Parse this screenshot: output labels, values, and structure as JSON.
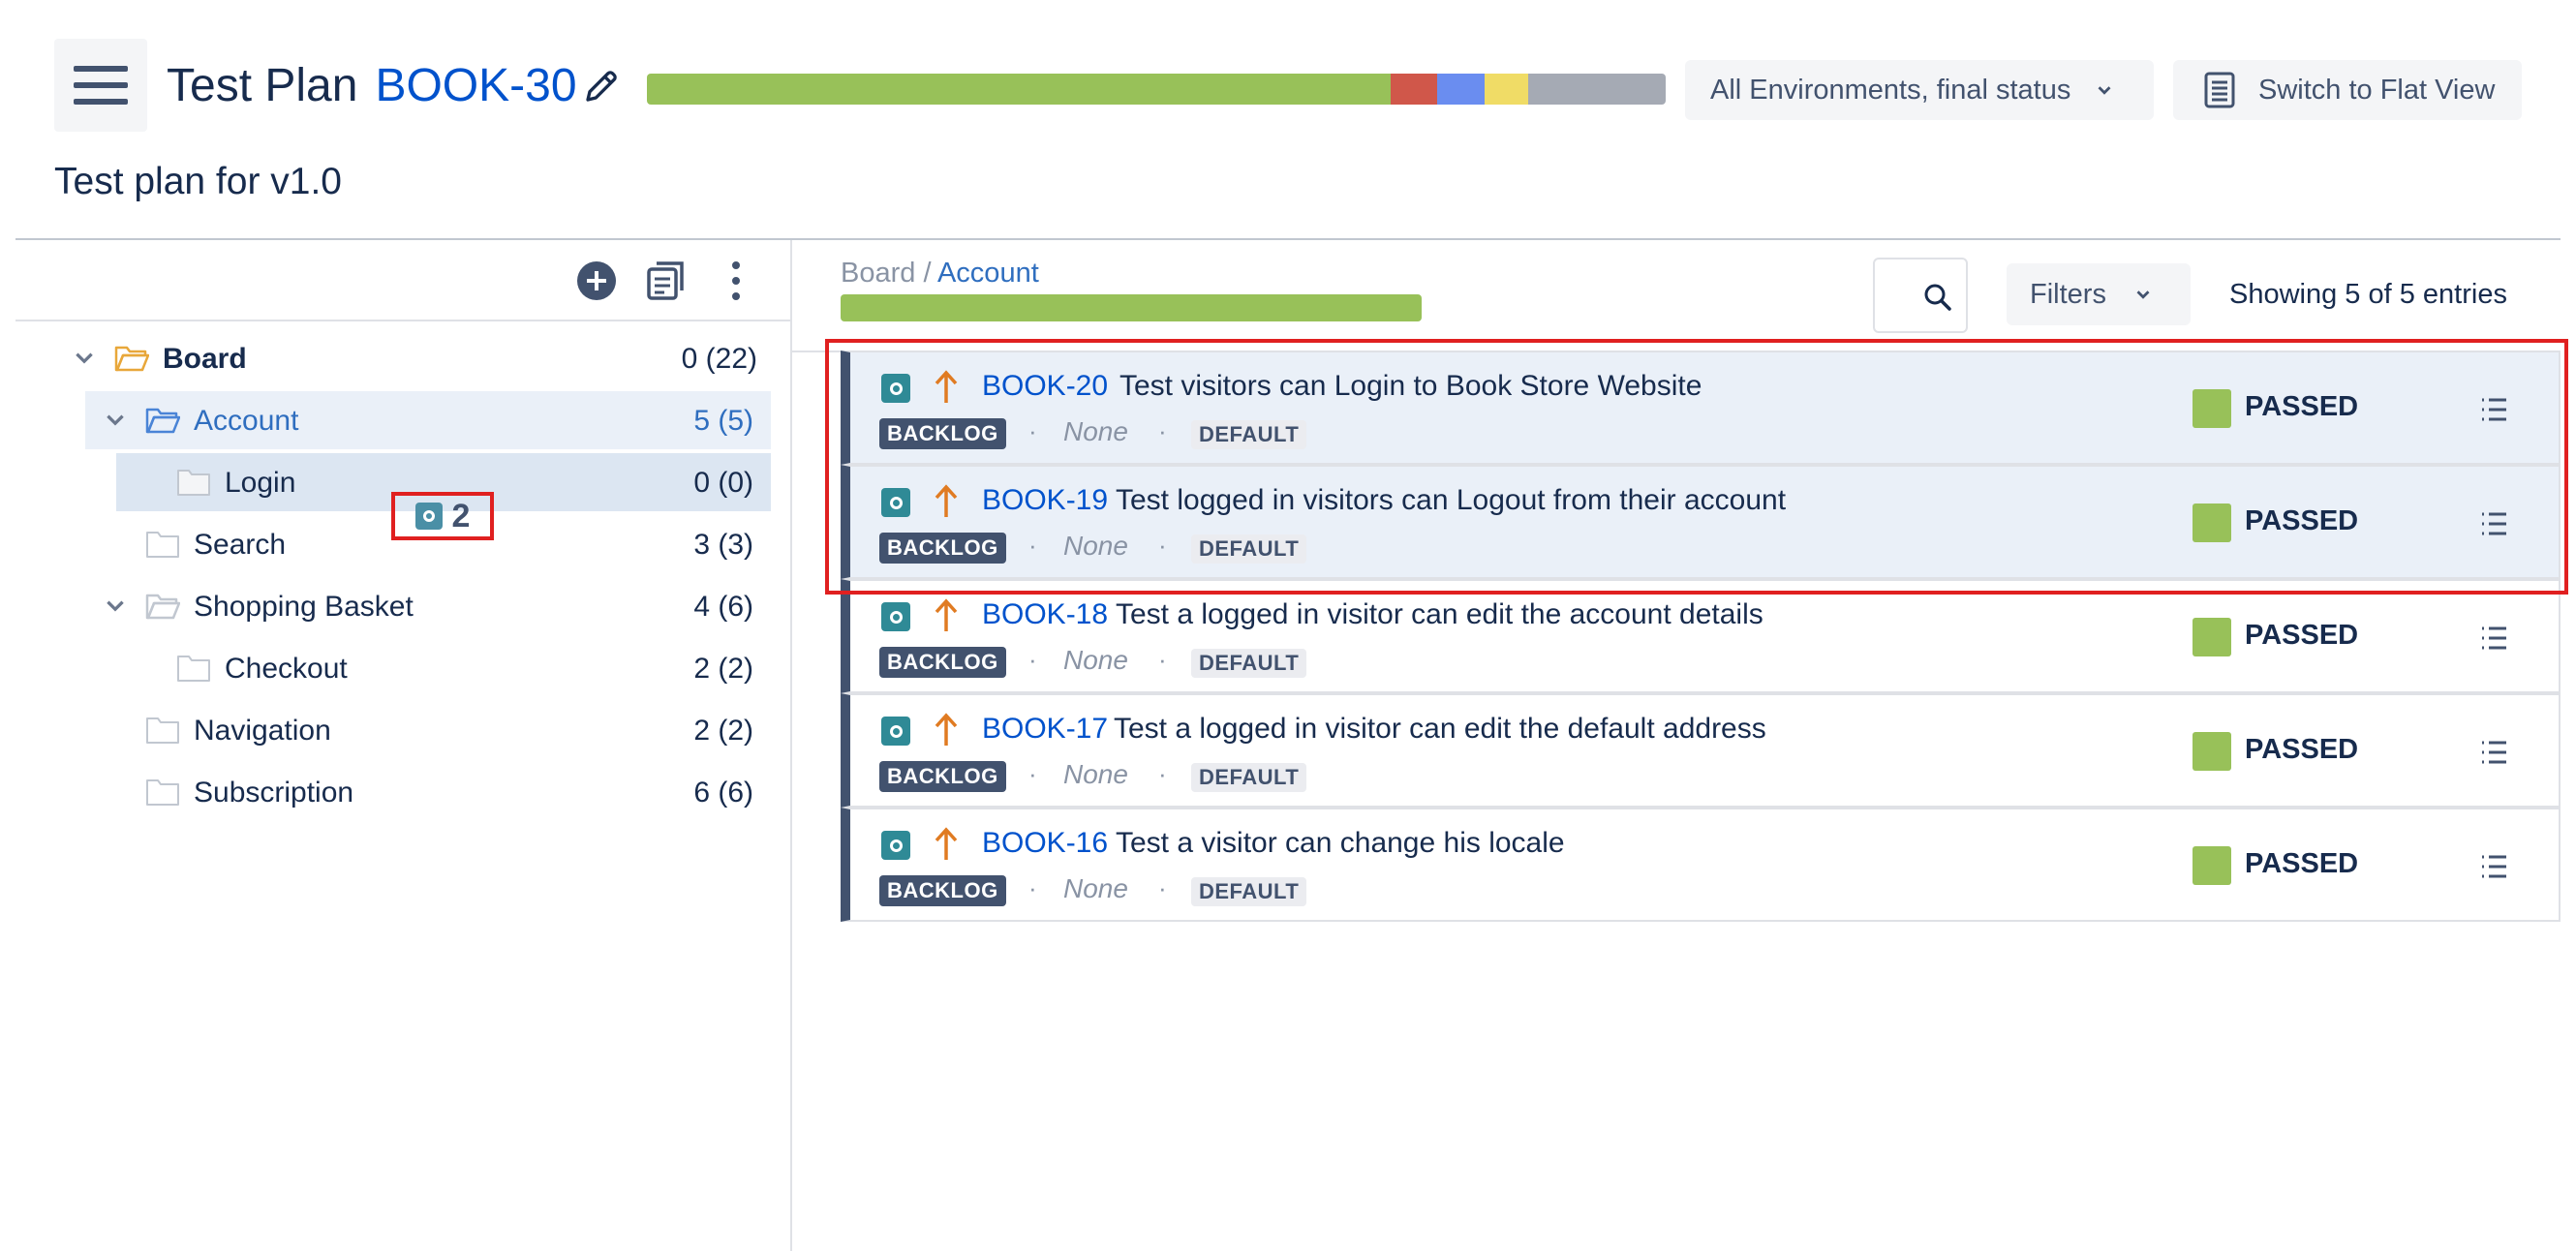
{
  "header": {
    "menu_icon": "hamburger-icon",
    "title_prefix": "Test Plan",
    "plan_key": "BOOK-30",
    "edit_icon": "pencil-icon",
    "progress_segments": [
      {
        "status": "passed",
        "color": "#98c159",
        "fraction": 0.73
      },
      {
        "status": "failed",
        "color": "#d0574a",
        "fraction": 0.046
      },
      {
        "status": "executing",
        "color": "#6a8df0",
        "fraction": 0.046
      },
      {
        "status": "todo",
        "color": "#f0dc66",
        "fraction": 0.043
      },
      {
        "status": "other",
        "color": "#a5aab4",
        "fraction": 0.135
      }
    ],
    "environment_select": "All Environments, final status",
    "flat_view_label": "Switch to Flat View",
    "flat_view_icon": "document-icon"
  },
  "subtitle": "Test plan for v1.0",
  "tree": {
    "toolbar_icons": [
      "add-icon",
      "copy-icon",
      "more-icon"
    ],
    "items": [
      {
        "label": "Board",
        "count": "0 (22)"
      },
      {
        "label": "Account",
        "count": "5 (5)"
      },
      {
        "label": "Login",
        "count": "0 (0)"
      },
      {
        "label": "Search",
        "count": "3 (3)"
      },
      {
        "label": "Shopping Basket",
        "count": "4 (6)"
      },
      {
        "label": "Checkout",
        "count": "2 (2)"
      },
      {
        "label": "Navigation",
        "count": "2 (2)"
      },
      {
        "label": "Subscription",
        "count": "6 (6)"
      }
    ],
    "drag_badge_count": "2"
  },
  "panel": {
    "breadcrumb_root": "Board",
    "breadcrumb_sep": " / ",
    "breadcrumb_current": "Account",
    "account_progress_fraction": 1.0,
    "filters_label": "Filters",
    "entries_text": "Showing 5 of 5 entries"
  },
  "tests": [
    {
      "key": "BOOK-20",
      "summary": "Test visitors can Login to Book Store Website",
      "status_label": "BACKLOG",
      "assignee": "None",
      "environment": "DEFAULT",
      "result": "PASSED"
    },
    {
      "key": "BOOK-19",
      "summary": "Test logged in visitors can Logout from their account",
      "status_label": "BACKLOG",
      "assignee": "None",
      "environment": "DEFAULT",
      "result": "PASSED"
    },
    {
      "key": "BOOK-18",
      "summary": "Test a logged in visitor can edit the account details",
      "status_label": "BACKLOG",
      "assignee": "None",
      "environment": "DEFAULT",
      "result": "PASSED"
    },
    {
      "key": "BOOK-17",
      "summary": "Test a logged in visitor can edit the default address",
      "status_label": "BACKLOG",
      "assignee": "None",
      "environment": "DEFAULT",
      "result": "PASSED"
    },
    {
      "key": "BOOK-16",
      "summary": "Test a visitor can change his locale",
      "status_label": "BACKLOG",
      "assignee": "None",
      "environment": "DEFAULT",
      "result": "PASSED"
    }
  ],
  "dot": "·"
}
